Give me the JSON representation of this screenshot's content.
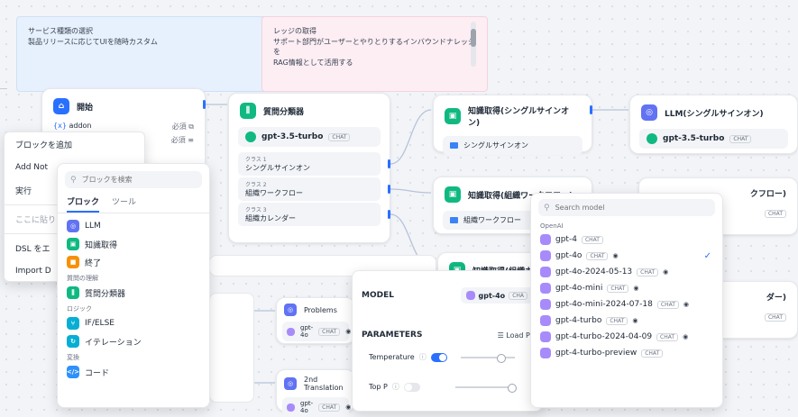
{
  "notes": [
    {
      "lines": [
        "サービス種類の選択",
        "製品リリースに応じてUIを随時カスタム"
      ]
    },
    {
      "lines": [
        "レッジの取得",
        "サポート部門がユーザーとやりとりするインバウンドナレッジを",
        "RAG情報として活用する"
      ]
    }
  ],
  "start_node": {
    "title": "開始",
    "var_name": "addon",
    "var_prefix": "{x}",
    "req1": "必須",
    "req2": "必須"
  },
  "classifier_node": {
    "title": "質問分類器",
    "model": "gpt-3.5-turbo",
    "model_tag": "CHAT",
    "classes": [
      {
        "label": "クラス 1",
        "value": "シングルサインオン"
      },
      {
        "label": "クラス 2",
        "value": "組織ワークフロー"
      },
      {
        "label": "クラス 3",
        "value": "組織カレンダー"
      }
    ]
  },
  "kr_sso_node": {
    "title": "知識取得(シングルサインオン)",
    "dataset": "シングルサインオン"
  },
  "llm_sso_node": {
    "title": "LLM(シングルサインオン)",
    "model": "gpt-3.5-turbo",
    "model_tag": "CHAT"
  },
  "kr_wf_node": {
    "title": "知識取得(組織ワークフロー)",
    "dataset": "組織ワークフロー"
  },
  "llm_wf_node": {
    "title_partial": "クフロー)",
    "tag": "CHAT"
  },
  "kr_cal_node": {
    "title": "知識取得(組織カ"
  },
  "right_partial_node": {
    "title_partial": "ダー)",
    "tag": "CHAT"
  },
  "problems_node": {
    "title": "Problems",
    "model": "gpt-4o",
    "tag": "CHAT"
  },
  "translation_node": {
    "title": "2nd Translation",
    "model": "gpt-4o",
    "tag": "CHAT"
  },
  "context_menu": {
    "items": [
      "ブロックを追加",
      "Add Not",
      "実行",
      "ここに貼り",
      "DSL をエ",
      "Import D"
    ]
  },
  "block_picker": {
    "search_placeholder": "ブロックを検索",
    "tabs": [
      "ブロック",
      "ツール"
    ],
    "items_top": [
      "LLM",
      "知識取得",
      "終了"
    ],
    "group_understanding": "質問の理解",
    "items_understanding": [
      "質問分類器"
    ],
    "group_logic": "ロジック",
    "items_logic": [
      "IF/ELSE",
      "イテレーション"
    ],
    "group_transform": "変換",
    "items_transform": [
      "コード"
    ]
  },
  "model_panel": {
    "model_label": "MODEL",
    "model_value": "gpt-4o",
    "model_tag": "CHA",
    "params_label": "PARAMETERS",
    "load_preset": "Load Pr",
    "temperature": "Temperature",
    "top_p": "Top P"
  },
  "model_dropdown": {
    "search_placeholder": "Search model",
    "provider": "OpenAI",
    "models": [
      {
        "name": "gpt-4",
        "tag": "CHAT",
        "vision": false,
        "selected": false
      },
      {
        "name": "gpt-4o",
        "tag": "CHAT",
        "vision": true,
        "selected": true
      },
      {
        "name": "gpt-4o-2024-05-13",
        "tag": "CHAT",
        "vision": true,
        "selected": false
      },
      {
        "name": "gpt-4o-mini",
        "tag": "CHAT",
        "vision": true,
        "selected": false
      },
      {
        "name": "gpt-4o-mini-2024-07-18",
        "tag": "CHAT",
        "vision": true,
        "selected": false
      },
      {
        "name": "gpt-4-turbo",
        "tag": "CHAT",
        "vision": true,
        "selected": false
      },
      {
        "name": "gpt-4-turbo-2024-04-09",
        "tag": "CHAT",
        "vision": true,
        "selected": false
      },
      {
        "name": "gpt-4-turbo-preview",
        "tag": "CHAT",
        "vision": false,
        "selected": false
      }
    ]
  },
  "colors": {
    "accent": "#2970ff",
    "green": "#10b981",
    "purple": "#a78bfa",
    "orange": "#f79009"
  }
}
